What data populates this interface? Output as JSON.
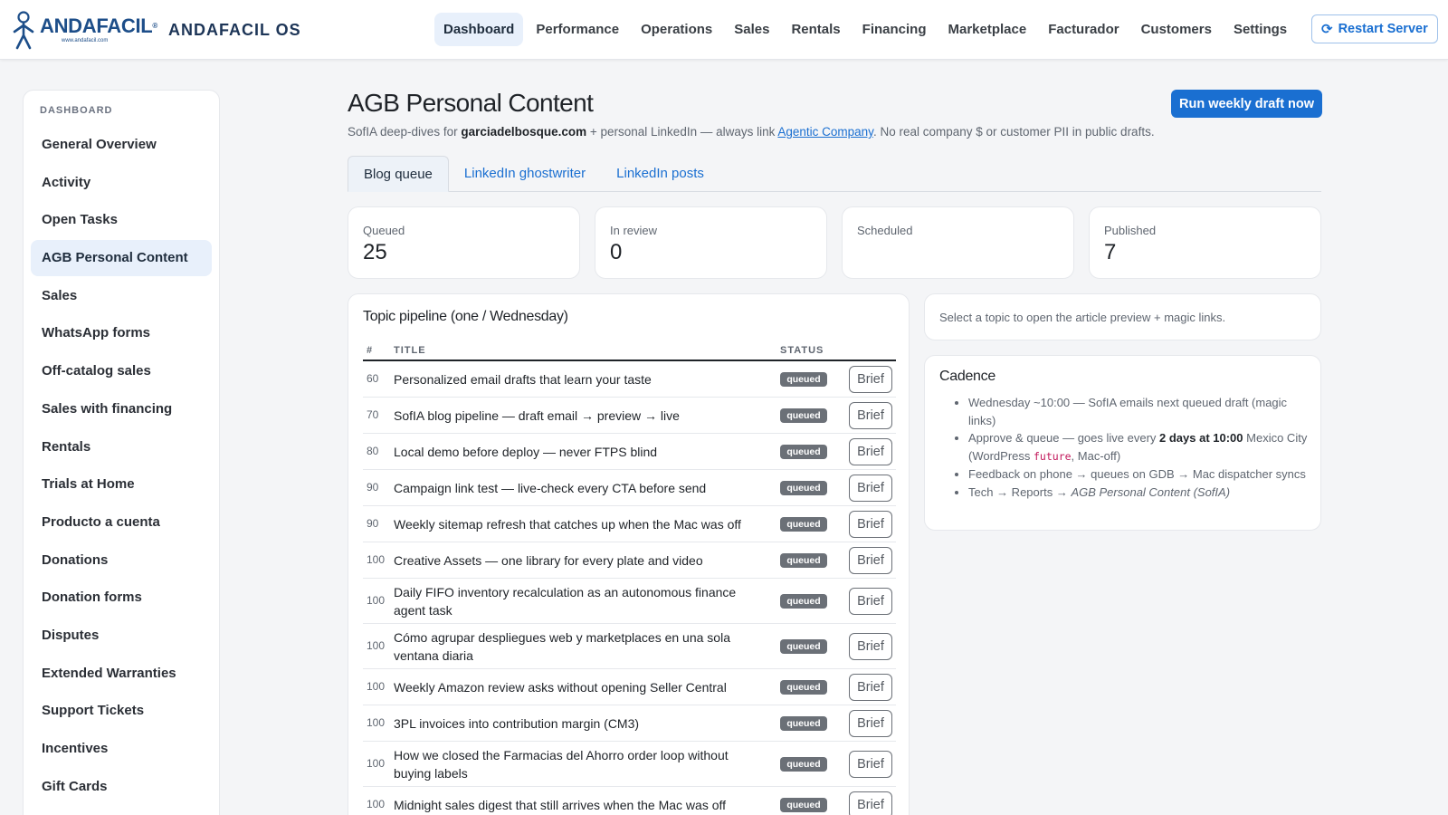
{
  "brand": {
    "logo_word": "ANDAFACIL",
    "logo_mark": "®",
    "logo_url": "www.andafacil.com",
    "name": "ANDAFACIL OS"
  },
  "nav": {
    "items": [
      "Dashboard",
      "Performance",
      "Operations",
      "Sales",
      "Rentals",
      "Financing",
      "Marketplace",
      "Facturador",
      "Customers",
      "Settings"
    ],
    "active": "Dashboard",
    "restart_label": "Restart Server"
  },
  "sidebar": {
    "heading": "DASHBOARD",
    "items": [
      "General Overview",
      "Activity",
      "Open Tasks",
      "AGB Personal Content",
      "Sales",
      "WhatsApp forms",
      "Off-catalog sales",
      "Sales with financing",
      "Rentals",
      "Trials at Home",
      "Producto a cuenta",
      "Donations",
      "Donation forms",
      "Disputes",
      "Extended Warranties",
      "Support Tickets",
      "Incentives",
      "Gift Cards"
    ],
    "active": "AGB Personal Content"
  },
  "page": {
    "title": "AGB Personal Content",
    "sub_prefix": "SofIA deep-dives for ",
    "sub_domain": "garciadelbosque.com",
    "sub_mid": " + personal LinkedIn — always link ",
    "sub_link": "Agentic Company",
    "sub_suffix": ". No real company $ or customer PII in public drafts.",
    "run_label": "Run weekly draft now"
  },
  "tabs": [
    "Blog queue",
    "LinkedIn ghostwriter",
    "LinkedIn posts"
  ],
  "active_tab": "Blog queue",
  "stats": [
    {
      "label": "Queued",
      "value": "25"
    },
    {
      "label": "In review",
      "value": "0"
    },
    {
      "label": "Scheduled",
      "value": ""
    },
    {
      "label": "Published",
      "value": "7"
    }
  ],
  "pipeline": {
    "title": "Topic pipeline (one / Wednesday)",
    "columns": {
      "num": "#",
      "title": "TITLE",
      "status": "STATUS"
    },
    "brief_label": "Brief",
    "rows": [
      {
        "num": "60",
        "title": "Personalized email drafts that learn your taste",
        "status": "queued"
      },
      {
        "num": "70",
        "title": "SofIA blog pipeline — draft email → preview → live",
        "status": "queued"
      },
      {
        "num": "80",
        "title": "Local demo before deploy — never FTPS blind",
        "status": "queued"
      },
      {
        "num": "90",
        "title": "Campaign link test — live-check every CTA before send",
        "status": "queued"
      },
      {
        "num": "90",
        "title": "Weekly sitemap refresh that catches up when the Mac was off",
        "status": "queued"
      },
      {
        "num": "100",
        "title": "Creative Assets — one library for every plate and video",
        "status": "queued"
      },
      {
        "num": "100",
        "title": "Daily FIFO inventory recalculation as an autonomous finance agent task",
        "status": "queued"
      },
      {
        "num": "100",
        "title": "Cómo agrupar despliegues web y marketplaces en una sola ventana diaria",
        "status": "queued"
      },
      {
        "num": "100",
        "title": "Weekly Amazon review asks without opening Seller Central",
        "status": "queued"
      },
      {
        "num": "100",
        "title": "3PL invoices into contribution margin (CM3)",
        "status": "queued"
      },
      {
        "num": "100",
        "title": "How we closed the Farmacias del Ahorro order loop without buying labels",
        "status": "queued"
      },
      {
        "num": "100",
        "title": "Midnight sales digest that still arrives when the Mac was off",
        "status": "queued"
      }
    ]
  },
  "hint": "Select a topic to open the article preview + magic links.",
  "cadence": {
    "title": "Cadence",
    "item1": "Wednesday ~10:00 — SofIA emails next queued draft (magic links)",
    "item2_a": "Approve & queue — goes live every ",
    "item2_b": "2 days at 10:00",
    "item2_c": " Mexico City (WordPress ",
    "item2_code": "future",
    "item2_d": ", Mac-off)",
    "item3": "Feedback on phone → queues on GDB → Mac dispatcher syncs",
    "item4_a": "Tech → Reports → ",
    "item4_b": "AGB Personal Content (SofIA)"
  },
  "colors": {
    "accent": "#1a6fd1",
    "active_bg": "#e8f0fb",
    "badge": "#6b7077",
    "brand": "#1d4e89"
  }
}
